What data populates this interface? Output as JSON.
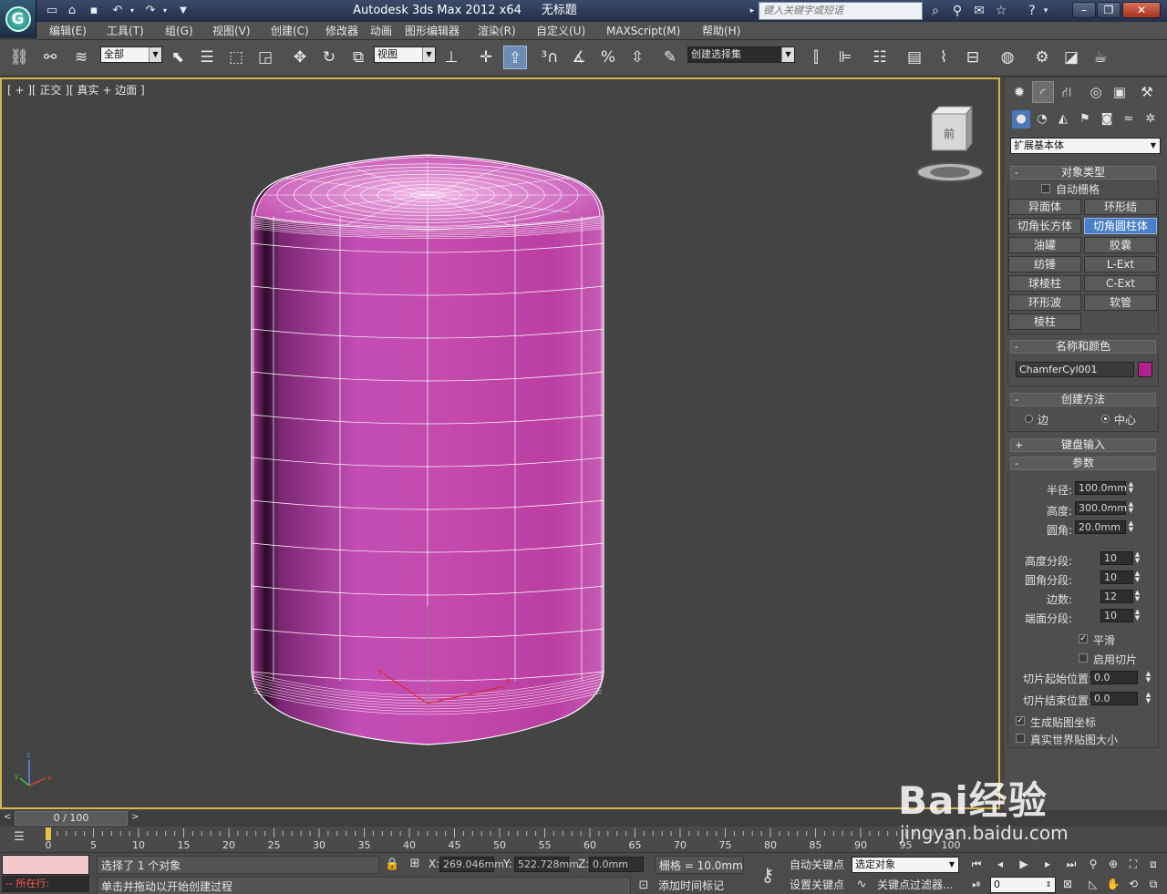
{
  "titlebar": {
    "app_title": "Autodesk 3ds Max  2012 x64",
    "doc_title": "无标题",
    "search_placeholder": "键入关键字或短语"
  },
  "menu": [
    "编辑(E)",
    "工具(T)",
    "组(G)",
    "视图(V)",
    "创建(C)",
    "修改器",
    "动画",
    "图形编辑器",
    "渲染(R)",
    "自定义(U)",
    "MAXScript(M)",
    "帮助(H)"
  ],
  "toolbar": {
    "selection_filter": "全部",
    "reference_coord": "视图",
    "named_selection": "创建选择集"
  },
  "viewport": {
    "label": "[ + ][ 正交 ][ 真实 + 边面 ]",
    "viewcube_face": "前",
    "object_color": "#c03aa5"
  },
  "command_panel": {
    "category": "扩展基本体",
    "object_type": {
      "title": "对象类型",
      "auto_grid_label": "自动栅格",
      "auto_grid_checked": false,
      "buttons": [
        "异面体",
        "环形结",
        "切角长方体",
        "切角圆柱体",
        "油罐",
        "胶囊",
        "纺锤",
        "L-Ext",
        "球棱柱",
        "C-Ext",
        "环形波",
        "软管",
        "棱柱"
      ],
      "active_button": "切角圆柱体"
    },
    "name_color": {
      "title": "名称和颜色",
      "name": "ChamferCyl001",
      "color": "#b0218e"
    },
    "creation_method": {
      "title": "创建方法",
      "option_edge": "边",
      "option_center": "中心",
      "selected": "中心"
    },
    "keyboard_entry": {
      "title": "键盘输入",
      "sign": "+"
    },
    "parameters": {
      "title": "参数",
      "sign": "-",
      "radius_label": "半径:",
      "radius": "100.0mm",
      "height_label": "高度:",
      "height": "300.0mm",
      "fillet_label": "圆角:",
      "fillet": "20.0mm",
      "height_segs_label": "高度分段:",
      "height_segs": "10",
      "fillet_segs_label": "圆角分段:",
      "fillet_segs": "10",
      "sides_label": "边数:",
      "sides": "12",
      "cap_segs_label": "端面分段:",
      "cap_segs": "10",
      "smooth_label": "平滑",
      "smooth": true,
      "slice_on_label": "启用切片",
      "slice_on": false,
      "slice_from_label": "切片起始位置:",
      "slice_from": "0.0",
      "slice_to_label": "切片结束位置:",
      "slice_to": "0.0",
      "gen_map_label": "生成贴图坐标",
      "gen_map": true,
      "real_world_label": "真实世界贴图大小",
      "real_world": false
    },
    "rollout_signs": {
      "collapse": "-"
    }
  },
  "timeline": {
    "frame_display": "0 / 100",
    "ticks": [
      "0",
      "5",
      "10",
      "15",
      "20",
      "25",
      "30",
      "35",
      "40",
      "45",
      "50",
      "55",
      "60",
      "65",
      "70",
      "75",
      "80",
      "85",
      "90",
      "95",
      "100"
    ]
  },
  "status": {
    "selection_info": "选择了 1 个对象",
    "prompt": "单击并拖动以开始创建过程",
    "here_label": "所在行:",
    "x_label": "X:",
    "x": "269.046mm",
    "y_label": "Y:",
    "y": "522.728mm",
    "z_label": "Z:",
    "z": "0.0mm",
    "grid": "栅格 = 10.0mm",
    "add_time_tag": "添加时间标记",
    "auto_key": "自动关键点",
    "set_key": "设置关键点",
    "selected_object": "选定对象",
    "key_filters": "关键点过滤器...",
    "current_frame": "0"
  },
  "watermark": {
    "brand": "Bai经验",
    "url": "jingyan.baidu.com"
  }
}
